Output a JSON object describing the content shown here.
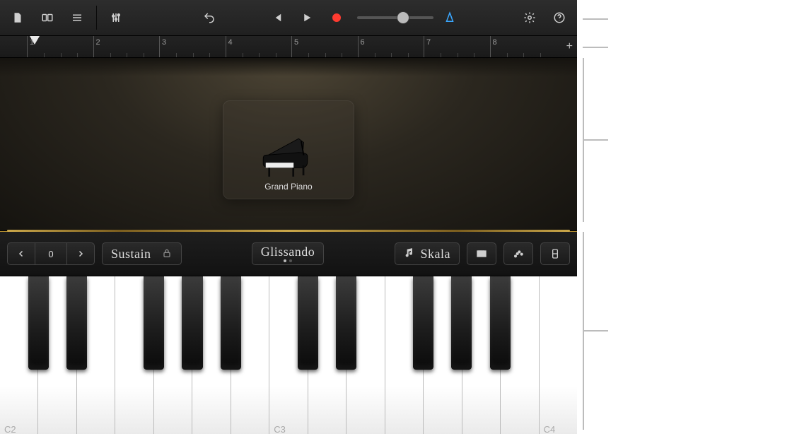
{
  "toolbar": {
    "icons": {
      "song": "song-icon",
      "browser": "browser-icon",
      "tracks": "tracks-icon",
      "mixer": "mixer-icon",
      "undo": "undo-icon",
      "rewind": "rewind-icon",
      "play": "play-icon",
      "record": "record-icon",
      "metronome": "metronome-icon",
      "settings": "gear-icon",
      "help": "help-icon"
    }
  },
  "ruler": {
    "bars": [
      "1",
      "2",
      "3",
      "4",
      "5",
      "6",
      "7",
      "8"
    ],
    "add_label": "+"
  },
  "instrument": {
    "name": "Grand Piano"
  },
  "strip": {
    "octave_value": "0",
    "sustain_label": "Sustain",
    "mode_label": "Glissando",
    "scale_label": "Skala"
  },
  "keyboard": {
    "labels": {
      "C2": "C2",
      "C3": "C3",
      "C4": "C4"
    }
  }
}
